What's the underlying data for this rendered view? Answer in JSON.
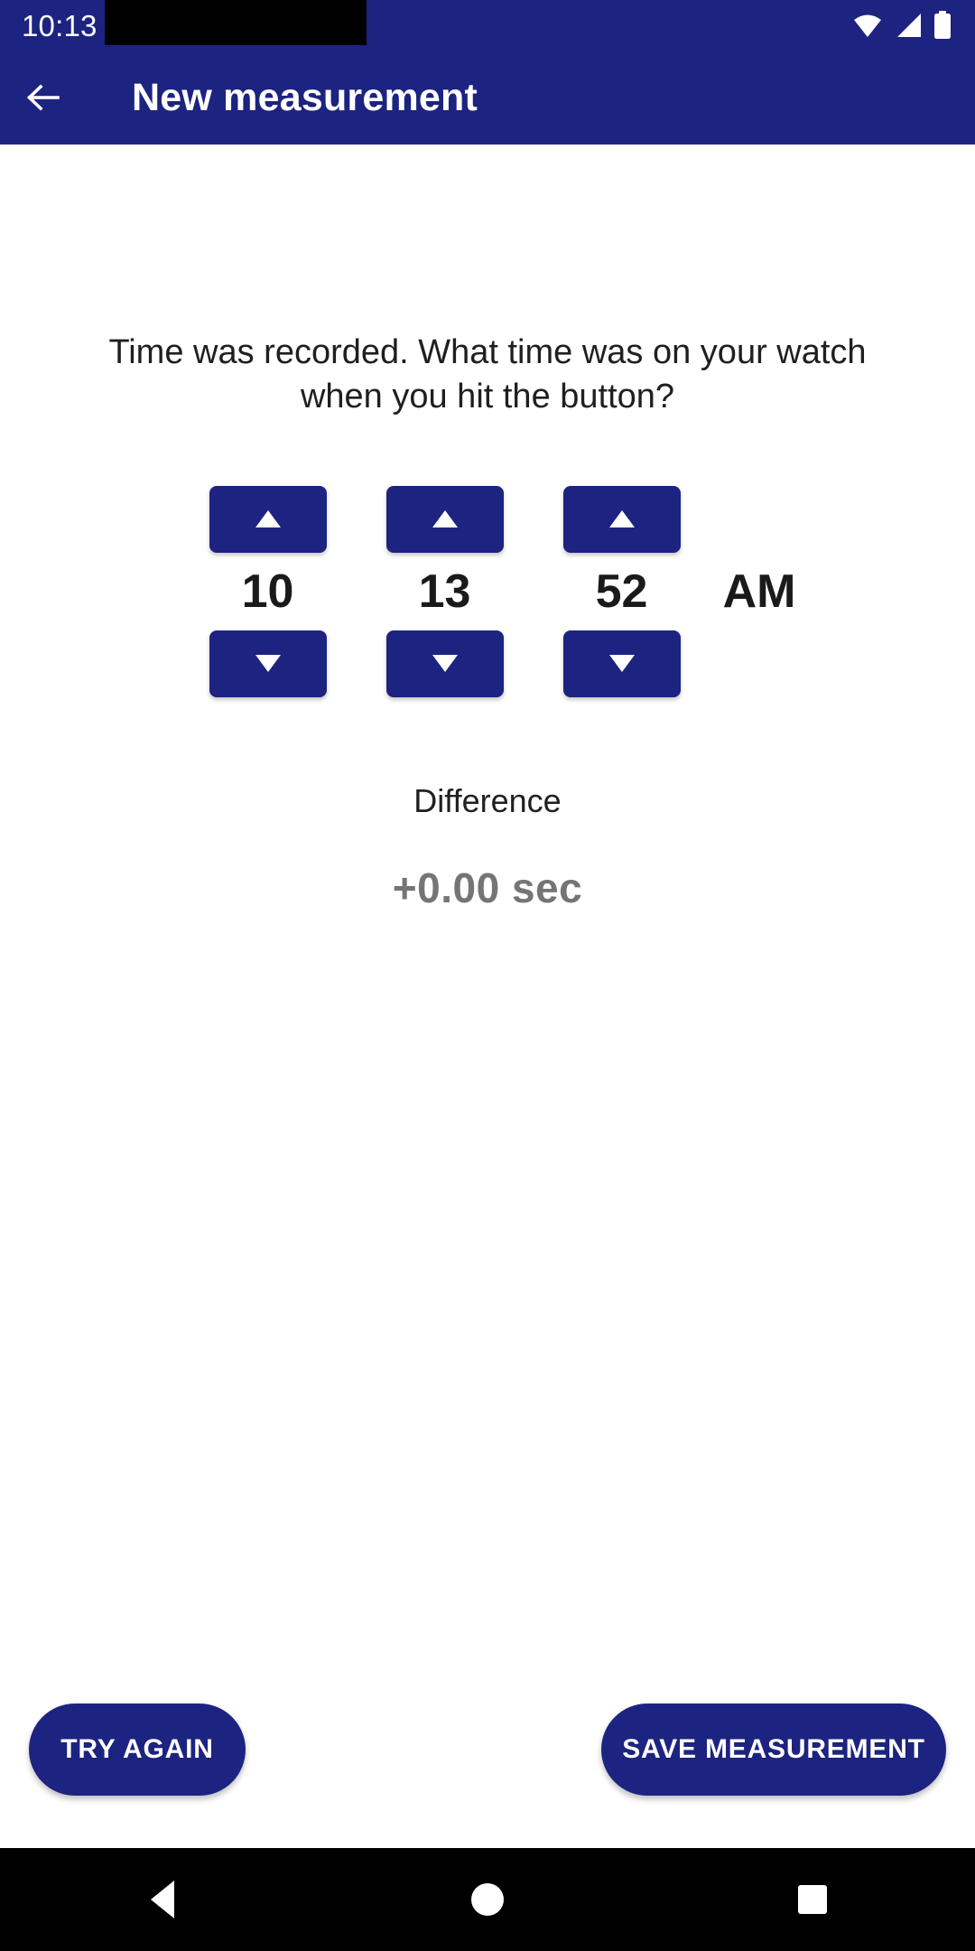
{
  "status_bar": {
    "time": "10:13",
    "icons": [
      "wifi-icon",
      "signal-icon",
      "battery-icon"
    ]
  },
  "app_bar": {
    "title": "New measurement",
    "back_icon": "back-arrow-icon",
    "background_color": "#1c2380"
  },
  "main": {
    "prompt": "Time was recorded. What time was on your watch when you hit the button?",
    "time_picker": {
      "fields": [
        {
          "name": "hour",
          "value": "10",
          "increment_label": "▲",
          "decrement_label": "▼"
        },
        {
          "name": "minute",
          "value": "13",
          "increment_label": "▲",
          "decrement_label": "▼"
        },
        {
          "name": "second",
          "value": "52",
          "increment_label": "▲",
          "decrement_label": "▼"
        }
      ],
      "meridiem": "AM"
    },
    "difference": {
      "label": "Difference",
      "value": "+0.00 sec",
      "value_color": "#757575"
    }
  },
  "actions": {
    "try_again": "TRY AGAIN",
    "save_measurement": "SAVE MEASUREMENT"
  },
  "nav_bar": {
    "back": "back-triangle-icon",
    "home": "home-circle-icon",
    "recents": "recents-square-icon"
  }
}
